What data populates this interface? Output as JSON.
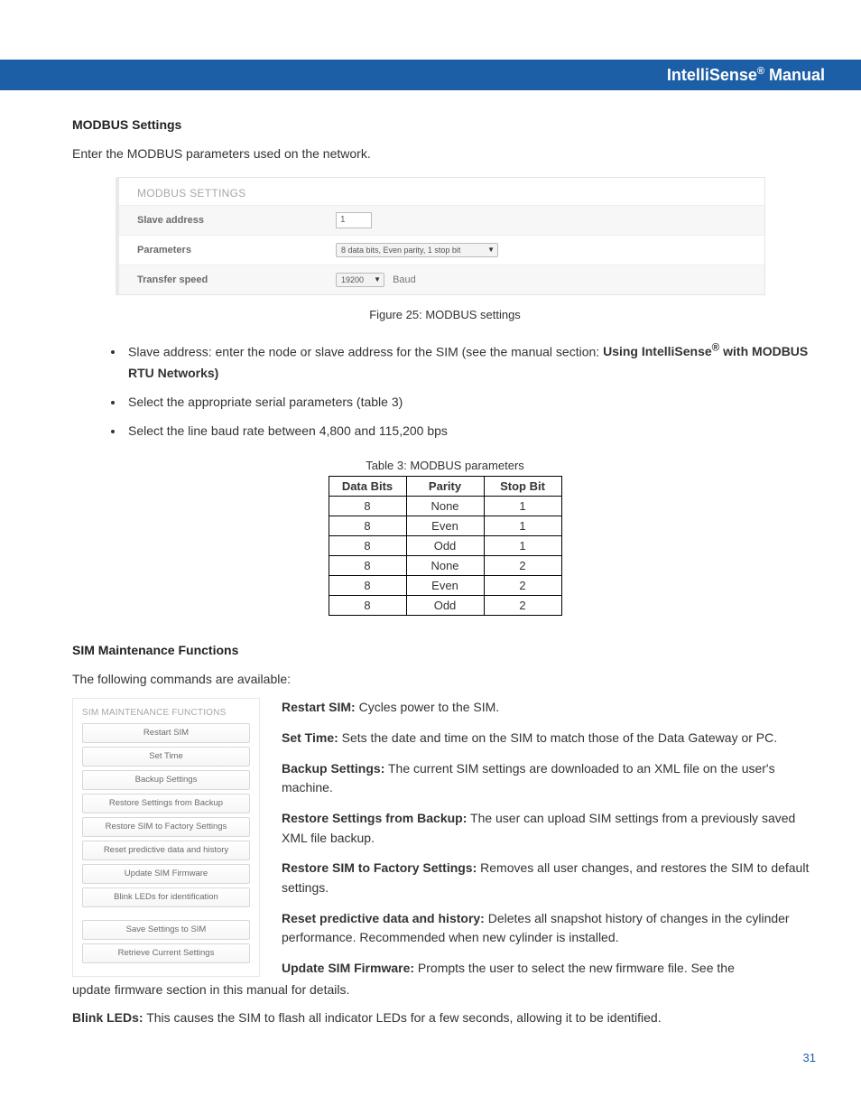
{
  "header": {
    "title_prefix": "IntelliSense",
    "title_reg": "®",
    "title_suffix": " Manual"
  },
  "section1": {
    "heading": "MODBUS Settings",
    "intro": "Enter the MODBUS parameters used on the network.",
    "panel_title": "MODBUS SETTINGS",
    "row_slave_label": "Slave address",
    "row_slave_value": "1",
    "row_params_label": "Parameters",
    "row_params_value": "8 data bits, Even parity, 1 stop bit",
    "row_speed_label": "Transfer speed",
    "row_speed_value": "19200",
    "row_speed_unit": "Baud",
    "caption": "Figure 25: MODBUS settings"
  },
  "bullets": {
    "b1a": "Slave address: enter the node or slave address for the SIM (see the manual section: ",
    "b1b": "Using IntelliSense",
    "b1c": "®",
    "b1d": " with MODBUS RTU Networks)",
    "b2": "Select the appropriate serial parameters (table 3)",
    "b3": "Select the line baud rate between 4,800 and 115,200 bps"
  },
  "table": {
    "caption": "Table 3: MODBUS parameters",
    "h1": "Data Bits",
    "h2": "Parity",
    "h3": "Stop Bit",
    "rows": [
      [
        "8",
        "None",
        "1"
      ],
      [
        "8",
        "Even",
        "1"
      ],
      [
        "8",
        "Odd",
        "1"
      ],
      [
        "8",
        "None",
        "2"
      ],
      [
        "8",
        "Even",
        "2"
      ],
      [
        "8",
        "Odd",
        "2"
      ]
    ]
  },
  "section2": {
    "heading": "SIM Maintenance Functions",
    "intro": "The following commands are available:",
    "panel_title": "SIM MAINTENANCE FUNCTIONS",
    "btns": [
      "Restart SIM",
      "Set Time",
      "Backup Settings",
      "Restore Settings from Backup",
      "Restore SIM to Factory Settings",
      "Reset predictive data and history",
      "Update SIM Firmware",
      "Blink LEDs for identification"
    ],
    "btns2": [
      "Save Settings to SIM",
      "Retrieve Current Settings"
    ]
  },
  "desc": {
    "restart_b": "Restart SIM:",
    "restart_t": "  Cycles power to the SIM.",
    "settime_b": "Set Time:",
    "settime_t": " Sets the date and time on the SIM to match those of the Data Gateway or PC.",
    "backup_b": "Backup Settings:",
    "backup_t": " The current SIM settings are downloaded to an XML file on the user's machine.",
    "restoreb_b": "Restore Settings from Backup:",
    "restoreb_t": " The user can upload SIM settings from a previously saved XML file backup.",
    "restoref_b": "Restore SIM to Factory Settings:",
    "restoref_t": " Removes all user changes, and restores the SIM to default settings.",
    "reset_b": "Reset predictive data and history:",
    "reset_t": " Deletes all snapshot history of changes in the cylinder performance.   Recommended when new cylinder is installed.",
    "update_b": "Update SIM Firmware:",
    "update_t": " Prompts the user to select the new firmware file. See the update firmware section in this manual for details.",
    "blink_b": "Blink LEDs:",
    "blink_t": " This causes the SIM to flash all indicator LEDs for a few seconds, allowing it to be identified."
  },
  "page_number": "31"
}
